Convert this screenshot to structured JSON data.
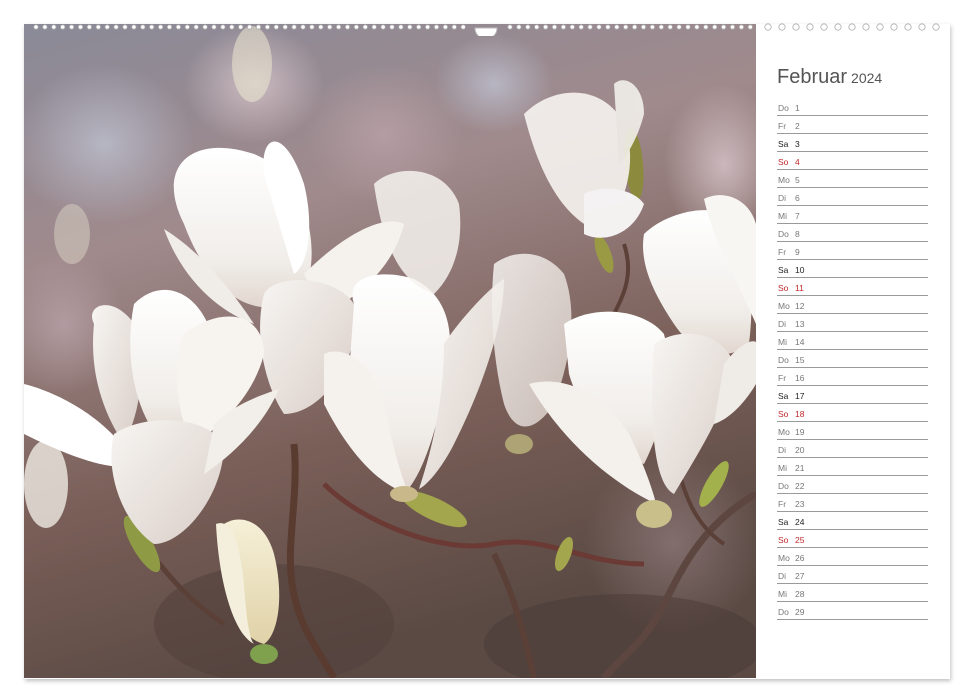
{
  "calendar": {
    "month": "Februar",
    "year": "2024",
    "days": [
      {
        "wd": "Do",
        "d": "1",
        "type": "weekday"
      },
      {
        "wd": "Fr",
        "d": "2",
        "type": "weekday"
      },
      {
        "wd": "Sa",
        "d": "3",
        "type": "sat"
      },
      {
        "wd": "So",
        "d": "4",
        "type": "sun"
      },
      {
        "wd": "Mo",
        "d": "5",
        "type": "weekday"
      },
      {
        "wd": "Di",
        "d": "6",
        "type": "weekday"
      },
      {
        "wd": "Mi",
        "d": "7",
        "type": "weekday"
      },
      {
        "wd": "Do",
        "d": "8",
        "type": "weekday"
      },
      {
        "wd": "Fr",
        "d": "9",
        "type": "weekday"
      },
      {
        "wd": "Sa",
        "d": "10",
        "type": "sat"
      },
      {
        "wd": "So",
        "d": "11",
        "type": "sun"
      },
      {
        "wd": "Mo",
        "d": "12",
        "type": "weekday"
      },
      {
        "wd": "Di",
        "d": "13",
        "type": "weekday"
      },
      {
        "wd": "Mi",
        "d": "14",
        "type": "weekday"
      },
      {
        "wd": "Do",
        "d": "15",
        "type": "weekday"
      },
      {
        "wd": "Fr",
        "d": "16",
        "type": "weekday"
      },
      {
        "wd": "Sa",
        "d": "17",
        "type": "sat"
      },
      {
        "wd": "So",
        "d": "18",
        "type": "sun"
      },
      {
        "wd": "Mo",
        "d": "19",
        "type": "weekday"
      },
      {
        "wd": "Di",
        "d": "20",
        "type": "weekday"
      },
      {
        "wd": "Mi",
        "d": "21",
        "type": "weekday"
      },
      {
        "wd": "Do",
        "d": "22",
        "type": "weekday"
      },
      {
        "wd": "Fr",
        "d": "23",
        "type": "weekday"
      },
      {
        "wd": "Sa",
        "d": "24",
        "type": "sat"
      },
      {
        "wd": "So",
        "d": "25",
        "type": "sun"
      },
      {
        "wd": "Mo",
        "d": "26",
        "type": "weekday"
      },
      {
        "wd": "Di",
        "d": "27",
        "type": "weekday"
      },
      {
        "wd": "Mi",
        "d": "28",
        "type": "weekday"
      },
      {
        "wd": "Do",
        "d": "29",
        "type": "weekday"
      }
    ]
  },
  "colors": {
    "sunday": "#c0282a",
    "saturday": "#222222",
    "weekday": "#777777",
    "rule": "#9a9a9a",
    "title": "#555555"
  },
  "photo": {
    "subject": "white magnolia blossoms"
  }
}
